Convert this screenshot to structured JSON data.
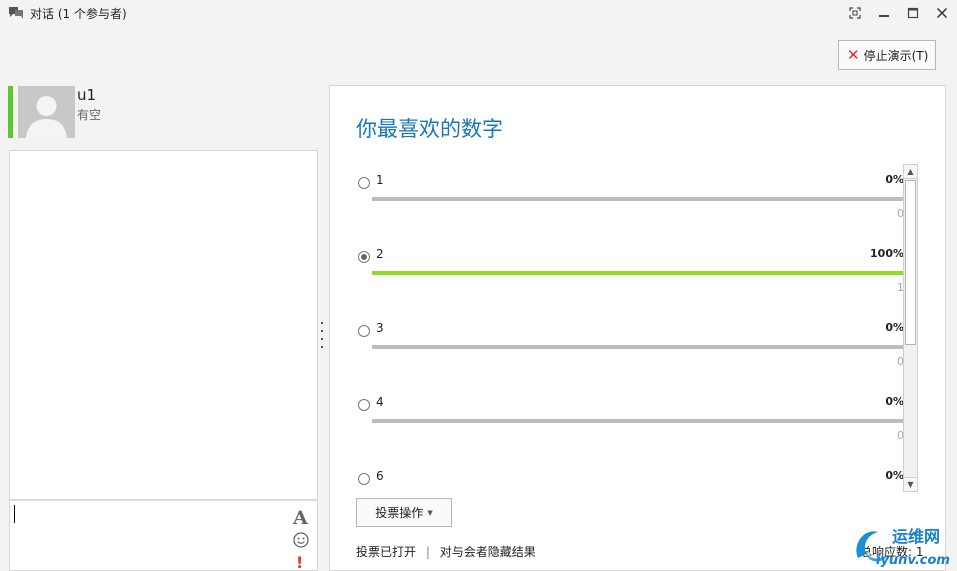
{
  "window": {
    "title": "对话 (1 个参与者)",
    "icons": [
      "conversation-icon",
      "fullscreen-icon",
      "minimize-icon",
      "maximize-icon",
      "close-icon"
    ]
  },
  "toolbar": {
    "stop_presenting": "停止演示(T)"
  },
  "participant": {
    "name": "u1",
    "status": "有空",
    "presence_color": "#5ec633"
  },
  "chat": {
    "tools": [
      "font-icon",
      "emoticon-icon",
      "priority-icon"
    ],
    "font_glyph": "A",
    "priority_glyph": "!"
  },
  "poll": {
    "title": "你最喜欢的数字",
    "options": [
      {
        "label": "1",
        "percent": "0%",
        "count": "0",
        "fraction": 0,
        "selected": false
      },
      {
        "label": "2",
        "percent": "100%",
        "count": "1",
        "fraction": 1,
        "selected": true
      },
      {
        "label": "3",
        "percent": "0%",
        "count": "0",
        "fraction": 0,
        "selected": false
      },
      {
        "label": "4",
        "percent": "0%",
        "count": "0",
        "fraction": 0,
        "selected": false
      },
      {
        "label": "6",
        "percent": "0%",
        "count": "",
        "fraction": 0,
        "selected": false
      }
    ],
    "bar_color": "#8fdc20",
    "actions_button": "投票操作",
    "status": "投票已打开",
    "hide_results_link": "对与会者隐藏结果",
    "total_responses": "总响应数: 1"
  },
  "colors": {
    "title_blue": "#1b76b8",
    "stop_icon_red": "#d9302a"
  },
  "watermark": {
    "text_cn": "运维网",
    "text_en": "iyunv.com"
  }
}
